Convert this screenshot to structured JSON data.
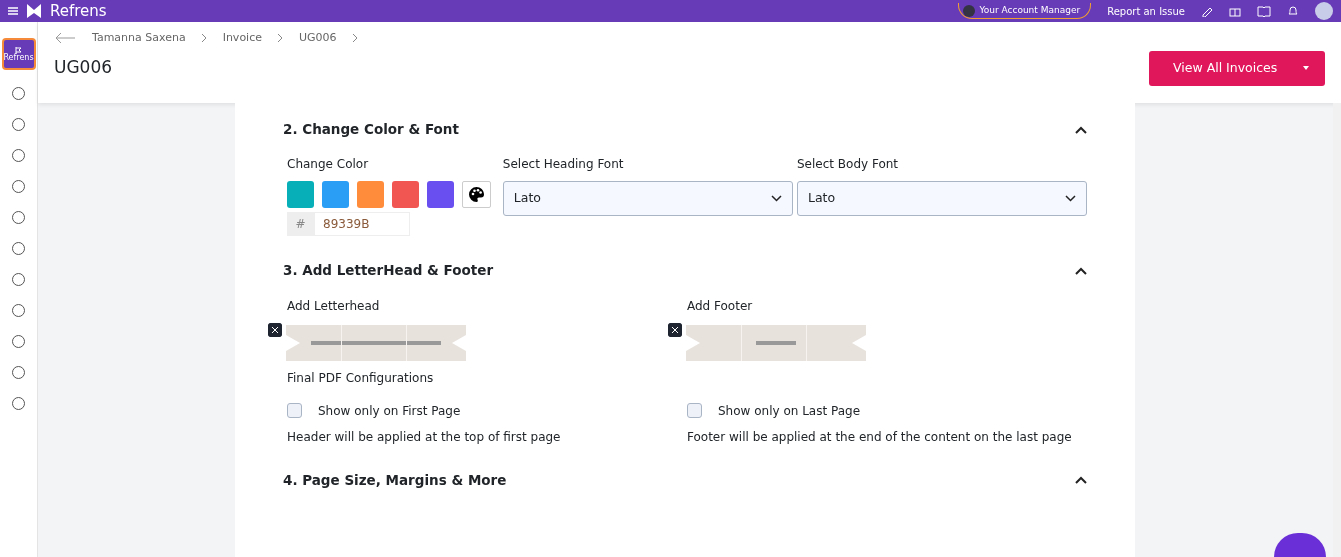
{
  "topbar": {
    "brand": "Refrens",
    "account_manager": "Your Account Manager",
    "report": "Report an Issue"
  },
  "breadcrumb": [
    "Tamanna Saxena",
    "Invoice",
    "UG006"
  ],
  "page_title": "UG006",
  "primary_button": "View All Invoices",
  "logo_tile": "Refrens",
  "sections": [
    {
      "title": "2. Change Color & Font",
      "expanded": true,
      "kind": "color"
    },
    {
      "title": "3. Add LetterHead & Footer",
      "expanded": true,
      "kind": "letterhead"
    },
    {
      "title": "4. Page Size, Margins & More",
      "expanded": true,
      "kind": "empty"
    }
  ],
  "color": {
    "label": "Change Color",
    "swatches": [
      {
        "color": "#07b0b8"
      },
      {
        "color": "#2a9df4"
      },
      {
        "color": "#ff8c3b"
      },
      {
        "color": "#f25652"
      },
      {
        "color": "#6a4ff0"
      }
    ],
    "hash": "#",
    "value": "89339B"
  },
  "fonts": [
    {
      "label": "Select Heading Font",
      "value": "Lato"
    },
    {
      "label": "Select Body Font",
      "value": "Lato"
    }
  ],
  "letterhead": {
    "columns": [
      {
        "label": "Add Letterhead",
        "config_title": "Final PDF Configurations",
        "option": "Show only on First Page",
        "checked": false,
        "note": "Header will be applied at the top of first page"
      },
      {
        "label": "Add Footer",
        "option": "Show only on Last Page",
        "checked": false,
        "note": "Footer will be applied at the end of the content on the last page"
      }
    ]
  }
}
